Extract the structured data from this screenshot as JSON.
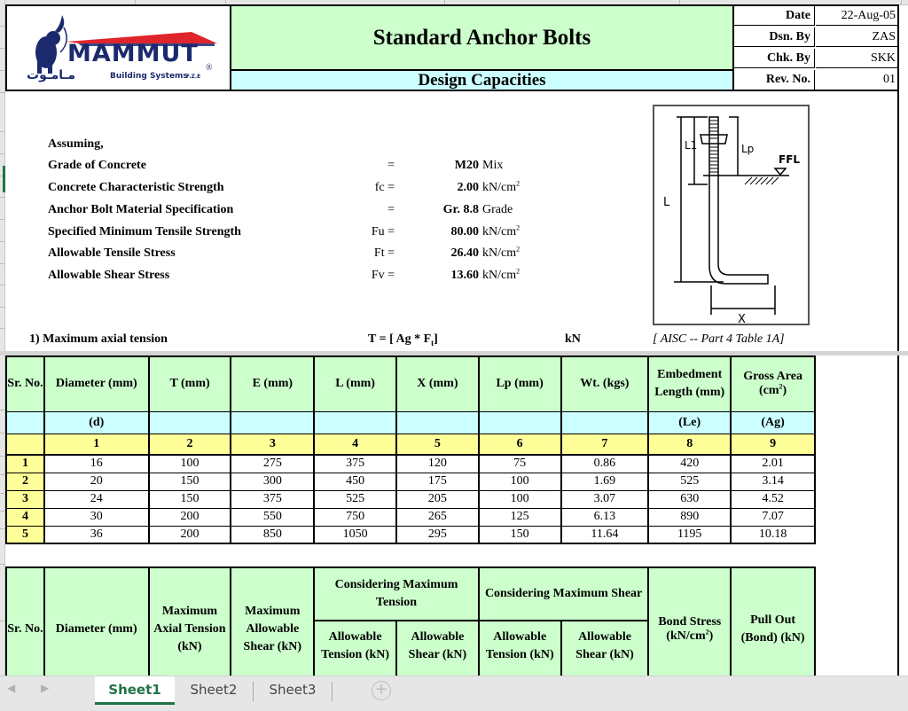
{
  "logo": {
    "brand": "MAMMUT",
    "arabic": "مـامـوت",
    "tagline": "Building Systems",
    "suffix": "F.Z.E",
    "registered": "®"
  },
  "header": {
    "title": "Standard Anchor Bolts",
    "subtitle": "Design Capacities"
  },
  "meta": [
    {
      "label": "Date",
      "value": "22-Aug-05"
    },
    {
      "label": "Dsn. By",
      "value": "ZAS"
    },
    {
      "label": "Chk. By",
      "value": "SKK"
    },
    {
      "label": "Rev. No.",
      "value": "01"
    }
  ],
  "assumptions": {
    "heading": "Assuming,",
    "items": [
      {
        "label": "Grade of Concrete",
        "symbol": "=",
        "value": "M20",
        "unit": "Mix",
        "unit_sup": ""
      },
      {
        "label": "Concrete Characteristic Strength",
        "symbol": "fc =",
        "value": "2.00",
        "unit": "kN/cm",
        "unit_sup": "2"
      },
      {
        "label": "Anchor Bolt Material Specification",
        "symbol": "=",
        "value": "Gr. 8.8",
        "unit": "Grade",
        "unit_sup": ""
      },
      {
        "label": "Specified Minimum Tensile Strength",
        "symbol": "Fu =",
        "value": "80.00",
        "unit": "kN/cm",
        "unit_sup": "2"
      },
      {
        "label": "Allowable Tensile Stress",
        "symbol": "Ft =",
        "value": "26.40",
        "unit": "kN/cm",
        "unit_sup": "2"
      },
      {
        "label": "Allowable Shear Stress",
        "symbol": "Fv =",
        "value": "13.60",
        "unit": "kN/cm",
        "unit_sup": "2"
      }
    ]
  },
  "diagram": {
    "labels": {
      "l1": "L1",
      "lp": "Lp",
      "ffl": "FFL",
      "l": "L",
      "x": "X"
    }
  },
  "section1": {
    "label": "1) Maximum axial tension",
    "formula_prefix": "T  = [ Ag * F",
    "formula_sub": "t",
    "formula_suffix": "]",
    "unit": "kN",
    "reference": "[ AISC  -- Part 4 Table 1A]"
  },
  "table1": {
    "headers": [
      "Sr. No.",
      "Diameter (mm)",
      "T (mm)",
      "E (mm)",
      "L (mm)",
      "X (mm)",
      "Lp (mm)",
      "Wt. (kgs)",
      "Embedment Length (mm)",
      "Gross Area (cm2)"
    ],
    "symbols": [
      "",
      "(d)",
      "",
      "",
      "",
      "",
      "",
      "",
      "(Le)",
      "(Ag)"
    ],
    "col_numbers": [
      "",
      "1",
      "2",
      "3",
      "4",
      "5",
      "6",
      "7",
      "8",
      "9"
    ],
    "rows": [
      [
        "1",
        "16",
        "100",
        "275",
        "375",
        "120",
        "75",
        "0.86",
        "420",
        "2.01"
      ],
      [
        "2",
        "20",
        "150",
        "300",
        "450",
        "175",
        "100",
        "1.69",
        "525",
        "3.14"
      ],
      [
        "3",
        "24",
        "150",
        "375",
        "525",
        "205",
        "100",
        "3.07",
        "630",
        "4.52"
      ],
      [
        "4",
        "30",
        "200",
        "550",
        "750",
        "265",
        "125",
        "6.13",
        "890",
        "7.07"
      ],
      [
        "5",
        "36",
        "200",
        "850",
        "1050",
        "295",
        "150",
        "11.64",
        "1195",
        "10.18"
      ]
    ]
  },
  "table2": {
    "sr_no": "Sr. No.",
    "diameter": "Diameter (mm)",
    "max_axial_tension": "Maximum Axial Tension (kN)",
    "max_allowable_shear": "Maximum Allowable Shear (kN)",
    "group_tension": "Considering Maximum Tension",
    "group_shear": "Considering Maximum Shear",
    "allow_tension": "Allowable Tension (kN)",
    "allow_shear": "Allowable Shear (kN)",
    "bond_stress": "Bond Stress",
    "bond_stress_unit": "(kN/cm",
    "bond_stress_sup": "2",
    "pull_out": "Pull Out (Bond) (kN)"
  },
  "sheet_tabs": [
    {
      "label": "Sheet1",
      "active": true
    },
    {
      "label": "Sheet2",
      "active": false
    },
    {
      "label": "Sheet3",
      "active": false
    }
  ],
  "colors": {
    "header_green": "#ccffcc",
    "symbol_cyan": "#ccffff",
    "index_yellow": "#ffff99",
    "excel_green": "#217346",
    "logo_navy": "#1a2a6c",
    "logo_red": "#e0242c"
  }
}
